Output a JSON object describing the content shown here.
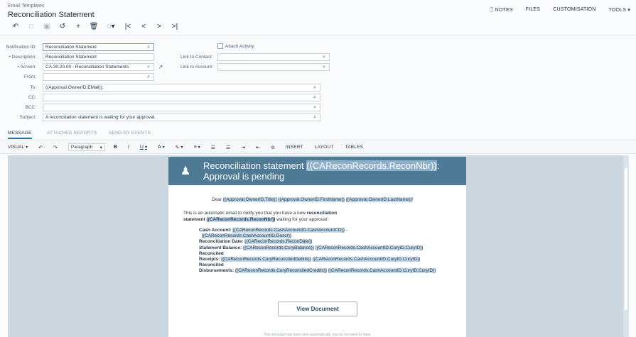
{
  "header": {
    "breadcrumb": "Email Templates",
    "title": "Reconciliation Statement",
    "links": [
      "NOTES",
      "FILES",
      "CUSTOMISATION",
      "TOOLS ▾"
    ],
    "notes_icon": "document-icon"
  },
  "toolbar": {
    "icons": [
      "undo-icon",
      "save-icon",
      "save-close-icon",
      "cancel-icon",
      "add-icon",
      "delete-icon",
      "copy-paste-icon",
      "first-icon",
      "previous-icon",
      "next-icon",
      "last-icon"
    ]
  },
  "form": {
    "notification_id": {
      "label": "Notification ID:",
      "value": "Reconciliation Statement"
    },
    "description": {
      "label": "Description:",
      "value": "Reconciliation Statement"
    },
    "screen": {
      "label": "Screen:",
      "value": "CA.30.20.00 - Reconciliation Statements"
    },
    "from": {
      "label": "From:",
      "value": ""
    },
    "to": {
      "label": "To:",
      "value": "((Approval.OwnerID.EMail));"
    },
    "cc": {
      "label": "CC:",
      "value": ""
    },
    "bcc": {
      "label": "BCC:",
      "value": ""
    },
    "subject": {
      "label": "Subject:",
      "value": "A reconciliation statement is waiting for your approval."
    },
    "attach_activity": {
      "label": "Attach Activity",
      "checked": false
    },
    "link_to_contact": {
      "label": "Link to Contact:",
      "value": ""
    },
    "link_to_account": {
      "label": "Link to Account:",
      "value": ""
    }
  },
  "tabs": [
    "MESSAGE",
    "ATTACHED REPORTS",
    "SEND BY EVENTS"
  ],
  "editor_toolbar": {
    "mode": "VISUAL",
    "format": "Paragraph",
    "insert": "INSERT",
    "layout": "LAYOUT",
    "tables": "TABLES"
  },
  "email": {
    "title_text": "Reconciliation statement ",
    "title_placeholder": "((CAReconRecords.ReconNbr))",
    "title_suffix": ":",
    "title_line2": "Approval is pending",
    "dear": "Dear",
    "owner_title": "((Approval.OwnerID.Title))",
    "owner_first": "((Approval.OwnerID.FirstName))",
    "owner_last": "((Approval.OwnerID.LastName))",
    "intro_text": "This is an automatic email to notify you that you have a new",
    "intro_bold1": "reconciliation",
    "intro_bold2": "statement",
    "intro_placeholder": "((CAReconRecords.ReconNbr))",
    "intro_suffix": "waiting for your approval:",
    "cash_account_label": "Cash Account:",
    "cash_account_value": "((CAReconRecords.CashAccountID.CashAccountCD))",
    "cash_account_descr": "((CAReconRecords.CashAccountID.Descr))",
    "recon_date_label": "Reconciliation Date:",
    "recon_date_value": "((CAReconRecords.ReconDate))",
    "statement_balance_label": "Statement Balance:",
    "statement_balance_value": "((CAReconRecords.CuryBalance))",
    "statement_balance_cury": "((CAReconRecords.CashAccountID.CuryID.CuryID))",
    "receipts_label_1": "Reconciled",
    "receipts_label_2": "Receipts:",
    "receipts_value": "((CAReconRecords.CuryReconciledDebits))",
    "receipts_cury": "((CAReconRecords.CashAccountID.CuryID.CuryID))",
    "disb_label_1": "Reconciled",
    "disb_label_2": "Disbursements:",
    "disb_value": "((CAReconRecords.CuryReconciledCredits))",
    "disb_cury": "((CAReconRecords.CashAccountID.CuryID.CuryID))",
    "button": "View Document",
    "footer": "This message has been sent automatically, you do not need to reply."
  },
  "colors": {
    "email_header": "#4e7a96",
    "placeholder_highlight": "#c7d8e6",
    "accent": "#2f6fa0"
  }
}
